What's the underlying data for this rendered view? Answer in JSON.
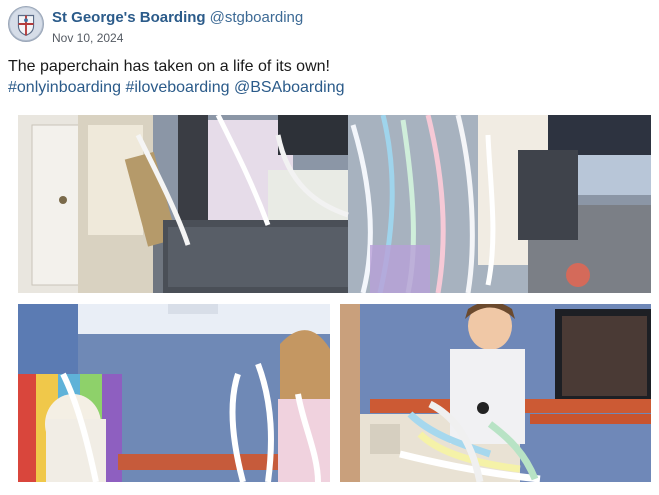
{
  "post": {
    "author": {
      "display_name": "St George's Boarding",
      "handle": "@stgboarding",
      "avatar_icon": "school-crest-icon"
    },
    "date": "Nov 10, 2024",
    "text": "The paperchain has taken on a life of its own!",
    "hashtags": [
      "#onlyinboarding",
      "#iloveboarding"
    ],
    "mention": "@BSAboarding"
  },
  "colors": {
    "link": "#2b5b8a",
    "handle": "#3d6a95"
  }
}
